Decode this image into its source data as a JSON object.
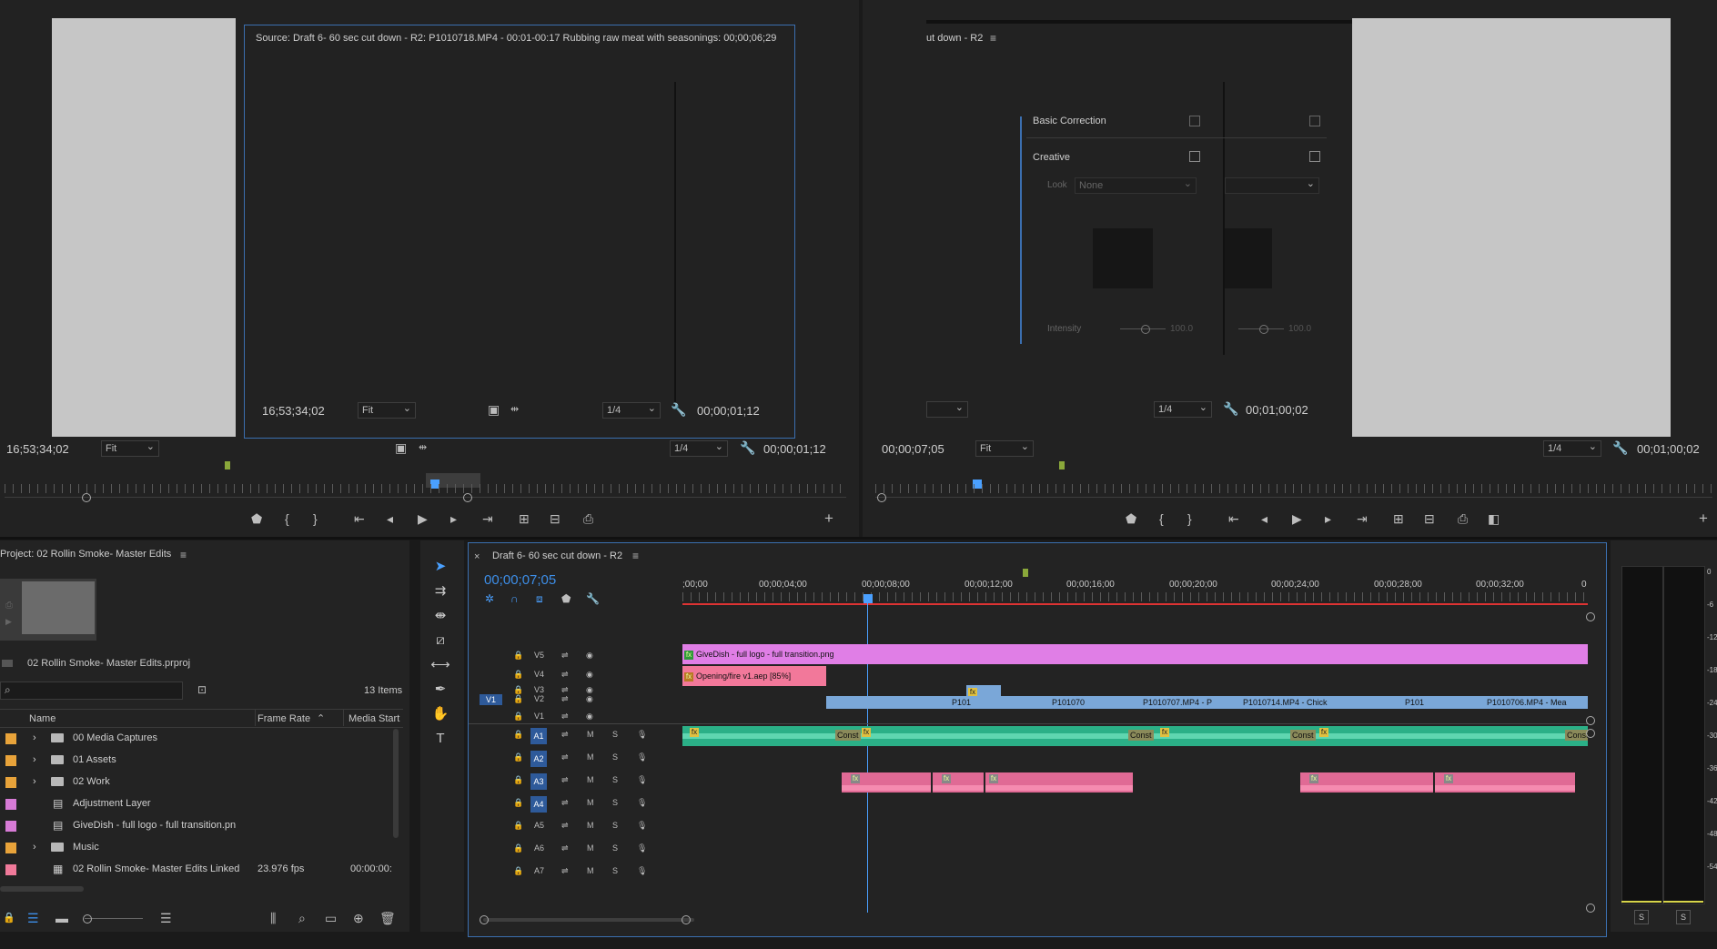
{
  "source_monitor": {
    "overlay_title": "Source: Draft 6- 60 sec cut down - R2: P1010718.MP4 - 00:01-00:17 Rubbing raw meat with seasonings: 00;00;06;29",
    "inner_timecode": "16;53;34;02",
    "inner_fit": "Fit",
    "inner_res": "1/4",
    "inner_duration": "00;00;01;12",
    "timecode": "16;53;34;02",
    "fit": "Fit",
    "res": "1/4",
    "duration": "00;00;01;12"
  },
  "program_monitor": {
    "overlay_title": "ut down - R2",
    "basic_correction": "Basic Correction",
    "creative": "Creative",
    "look_label": "Look",
    "look_value": "None",
    "intensity_label": "Intensity",
    "intensity_value": "100.0",
    "intensity_value2": "100.0",
    "inner_res": "1/4",
    "inner_duration": "00;01;00;02",
    "timecode": "00;00;07;05",
    "fit": "Fit",
    "res": "1/4",
    "duration": "00;01;00;02"
  },
  "project": {
    "title": "Project: 02 Rollin Smoke- Master Edits",
    "filename": "02 Rollin Smoke- Master Edits.prproj",
    "item_count": "13 Items",
    "columns": [
      "Name",
      "Frame Rate",
      "Media Start"
    ],
    "items": [
      {
        "name": "00 Media Captures",
        "color": "#e8a33a",
        "type": "folder",
        "fps": "",
        "start": ""
      },
      {
        "name": "01 Assets",
        "color": "#e8a33a",
        "type": "folder",
        "fps": "",
        "start": ""
      },
      {
        "name": "02 Work",
        "color": "#e8a33a",
        "type": "folder",
        "fps": "",
        "start": ""
      },
      {
        "name": "Adjustment Layer",
        "color": "#d77bd6",
        "type": "file",
        "fps": "",
        "start": ""
      },
      {
        "name": "GiveDish - full logo - full transition.pn",
        "color": "#d77bd6",
        "type": "file",
        "fps": "",
        "start": ""
      },
      {
        "name": "Music",
        "color": "#e8a33a",
        "type": "folder",
        "fps": "",
        "start": ""
      },
      {
        "name": "02 Rollin Smoke- Master Edits Linked",
        "color": "#f07a9a",
        "type": "sequence",
        "fps": "23.976 fps",
        "start": "00:00:00:"
      }
    ]
  },
  "timeline": {
    "tab_title": "Draft 6- 60 sec cut down - R2",
    "timecode": "00;00;07;05",
    "ruler_labels": [
      ";00;00",
      "00;00;04;00",
      "00;00;08;00",
      "00;00;12;00",
      "00;00;16;00",
      "00;00;20;00",
      "00;00;24;00",
      "00;00;28;00",
      "00;00;32;00",
      "0"
    ],
    "video_tracks": [
      "V5",
      "V4",
      "V3",
      "V2",
      "V1"
    ],
    "source_patch": "V1",
    "audio_tracks": [
      "A1",
      "A2",
      "A3",
      "A4",
      "A5",
      "A6",
      "A7"
    ],
    "clips": {
      "v5": "GiveDish - full logo - full transition.png",
      "v4": "Opening/fire v1.aep [85%]",
      "v2a": "P101",
      "v2b": "P101070",
      "v2c": "P1010707.MP4 - P",
      "v2d": "P1010714.MP4 - Chick",
      "v2e": "P101",
      "v2f": "P1010706.MP4 - Mea",
      "const": "Const"
    },
    "mute": "M",
    "solo": "S"
  },
  "audio_meter": {
    "solo_left": "S",
    "solo_right": "S",
    "scale": [
      "0",
      "-6",
      "-12",
      "-18",
      "-24",
      "-30",
      "-36",
      "-42",
      "-48",
      "-54"
    ]
  },
  "colors": {
    "accent": "#3d8ee8",
    "v5_clip": "#e07ee6",
    "v4_clip": "#f2789a",
    "video_clip": "#7aa7d8",
    "audio_green": "#2bb087",
    "audio_pink": "#e06a95",
    "playhead": "#4aa0ff"
  }
}
